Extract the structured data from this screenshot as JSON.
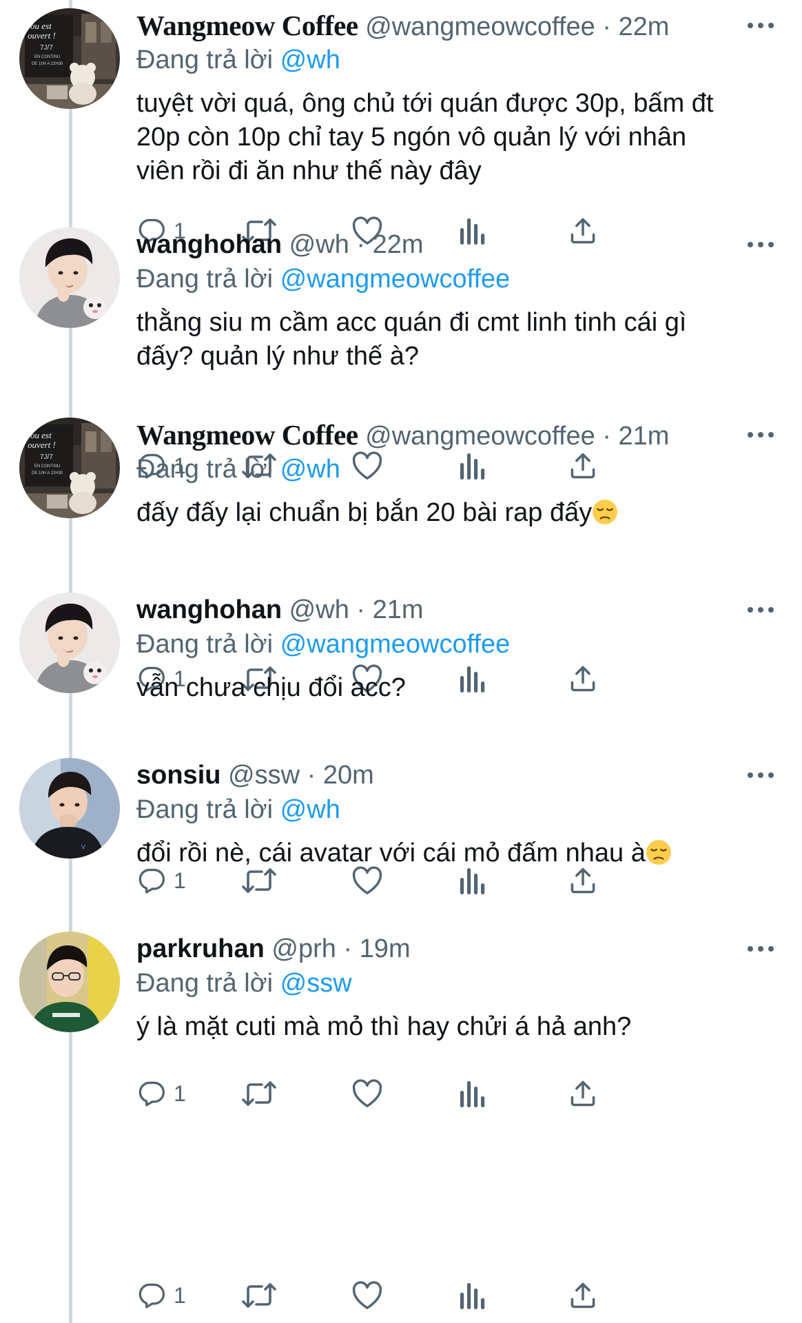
{
  "tweets": [
    {
      "avatar": "coffee-shop-avatar",
      "name": "Wangmeow Coffee",
      "handle": "@wangmeowcoffee",
      "separator": "·",
      "time": "22m",
      "replying_prefix": "Đang trả lời",
      "replying_to": "@wh",
      "text": "tuyệt vời quá, ông chủ tới quán được 30p, bấm đt\n20p còn 10p chỉ tay 5 ngón vô quản lý với nhân\nviên rồi đi ăn như thế này đây",
      "reply_count": "1"
    },
    {
      "avatar": "wanghohan-avatar",
      "name": "wanghohan",
      "handle": "@wh",
      "separator": "·",
      "time": "22m",
      "replying_prefix": "Đang trả lời",
      "replying_to": "@wangmeowcoffee",
      "text": "thằng siu m cầm acc quán đi cmt linh tinh cái gì\nđấy? quản lý như thế à?",
      "reply_count": "1"
    },
    {
      "avatar": "coffee-shop-avatar",
      "name": "Wangmeow Coffee",
      "handle": "@wangmeowcoffee",
      "separator": "·",
      "time": "21m",
      "replying_prefix": "Đang trả lời",
      "replying_to": "@wh",
      "text": "đấy đấy lại chuẩn bị bắn 20 bài rap đấy",
      "emoji": "pensive-face",
      "reply_count": "1"
    },
    {
      "avatar": "wanghohan-avatar",
      "name": "wanghohan",
      "handle": "@wh",
      "separator": "·",
      "time": "21m",
      "replying_prefix": "Đang trả lời",
      "replying_to": "@wangmeowcoffee",
      "text": "vẫn chưa chịu đổi acc?",
      "reply_count": "1"
    },
    {
      "avatar": "sonsiu-avatar",
      "name": "sonsiu",
      "handle": "@ssw",
      "separator": "·",
      "time": "20m",
      "replying_prefix": "Đang trả lời",
      "replying_to": "@wh",
      "text": "đổi rồi nè, cái avatar với cái mỏ đấm nhau à",
      "emoji": "pensive-face",
      "reply_count": "1"
    },
    {
      "avatar": "parkruhan-avatar",
      "name": "parkruhan",
      "handle": "@prh",
      "separator": "·",
      "time": "19m",
      "replying_prefix": "Đang trả lời",
      "replying_to": "@ssw",
      "text": "ý là mặt cuti mà mỏ thì hay chửi á hả anh?",
      "reply_count": "1"
    }
  ],
  "icons": {
    "reply": "reply-icon",
    "retweet": "retweet-icon",
    "like": "like-icon",
    "analytics": "analytics-icon",
    "share": "share-icon",
    "more": "more-icon"
  },
  "colors": {
    "text": "#0f1419",
    "secondary": "#536471",
    "link": "#1d9bf0",
    "thread_line": "#cfd9de"
  }
}
